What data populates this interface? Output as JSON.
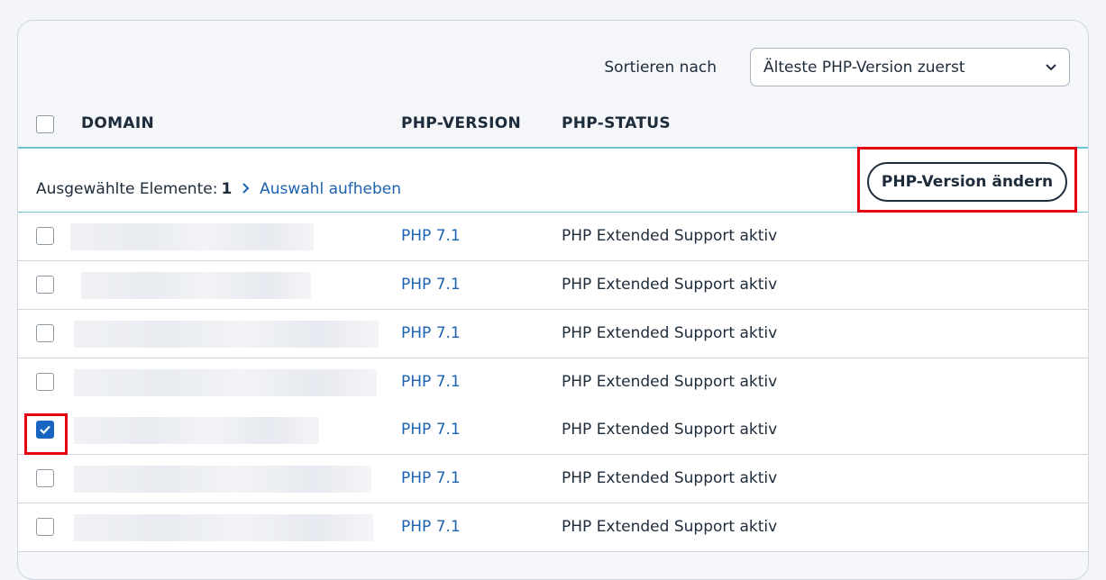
{
  "sort": {
    "label": "Sortieren nach",
    "selected": "Älteste PHP-Version zuerst"
  },
  "columns": {
    "domain": "DOMAIN",
    "php_version": "PHP-VERSION",
    "php_status": "PHP-STATUS"
  },
  "selection": {
    "prefix": "Ausgewählte Elemente:",
    "count": "1",
    "clear_label": "Auswahl aufheben",
    "change_button": "PHP-Version ändern"
  },
  "rows": [
    {
      "php": "PHP 7.1",
      "status": "PHP Extended Support aktiv",
      "checked": false
    },
    {
      "php": "PHP 7.1",
      "status": "PHP Extended Support aktiv",
      "checked": false
    },
    {
      "php": "PHP 7.1",
      "status": "PHP Extended Support aktiv",
      "checked": false
    },
    {
      "php": "PHP 7.1",
      "status": "PHP Extended Support aktiv",
      "checked": false
    },
    {
      "php": "PHP 7.1",
      "status": "PHP Extended Support aktiv",
      "checked": true
    },
    {
      "php": "PHP 7.1",
      "status": "PHP Extended Support aktiv",
      "checked": false
    },
    {
      "php": "PHP 7.1",
      "status": "PHP Extended Support aktiv",
      "checked": false
    }
  ],
  "colors": {
    "accent": "#1765c0",
    "link": "#1c62b0",
    "highlight": "#e3000f",
    "divider": "#6cc3d5"
  }
}
